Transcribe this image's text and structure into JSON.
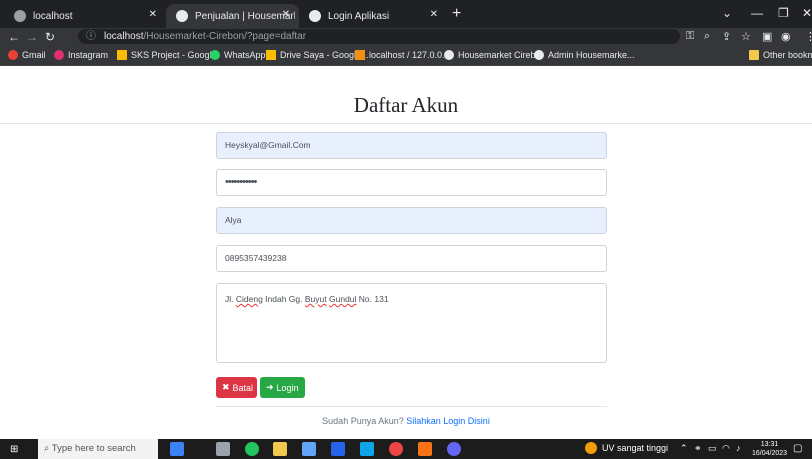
{
  "browser": {
    "tabs": [
      {
        "title": "localhost"
      },
      {
        "title": "Penjualan | Housemarket Cirebon"
      },
      {
        "title": "Login Aplikasi"
      }
    ],
    "url_host": "localhost",
    "url_path": "/Housemarket-Cirebon/?page=daftar",
    "bookmarks": [
      {
        "label": "Gmail"
      },
      {
        "label": "Instagram"
      },
      {
        "label": "SKS Project - Googl..."
      },
      {
        "label": "WhatsApp"
      },
      {
        "label": "Drive Saya - Google..."
      },
      {
        "label": "localhost / 127.0.0...."
      },
      {
        "label": "Housemarket Cireb..."
      },
      {
        "label": "Admin Housemarke..."
      },
      {
        "label": "Other bookmarks"
      }
    ]
  },
  "page": {
    "title": "Daftar Akun",
    "fields": {
      "email": "Heyskyal@Gmail.Com",
      "password": "•••••••••••",
      "name": "Alya",
      "phone": "0895357439238",
      "address_pre": "Jl. ",
      "address_w1": "Cideng",
      "address_mid": " Indah Gg. ",
      "address_w2": "Buyut",
      "address_sp": " ",
      "address_w3": "Gundul",
      "address_post": " No. 131"
    },
    "buttons": {
      "cancel": "Batal",
      "login": "Login"
    },
    "footer_text": "Sudah Punya Akun?",
    "footer_link": "Silahkan Login Disini"
  },
  "taskbar": {
    "search_placeholder": "Type here to search",
    "weather": "UV sangat tinggi",
    "time": "13:31",
    "date": "16/04/2023"
  },
  "colors": {
    "danger": "#dc3545",
    "success": "#28a745",
    "autofill": "#e8f0fe",
    "link": "#0d6efd"
  }
}
